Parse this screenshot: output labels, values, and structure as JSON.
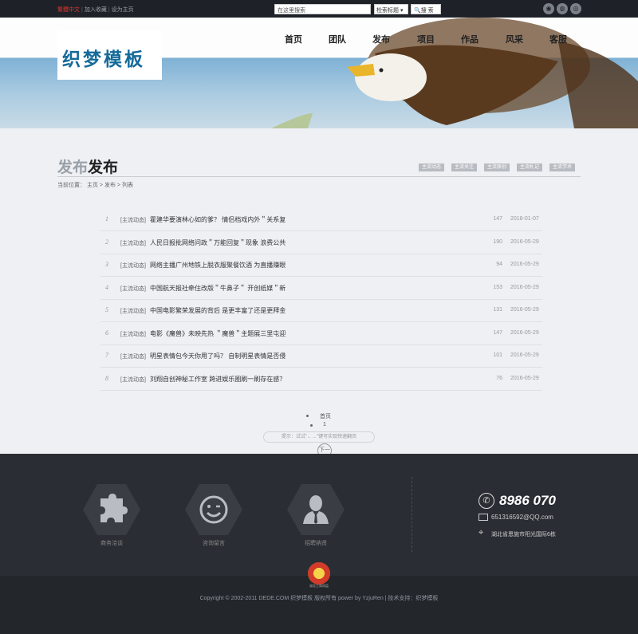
{
  "topbar": {
    "link_chinese": "繁體中文",
    "link_favorite": "加入收藏",
    "link_homepage": "设为主页",
    "search_placeholder": "在这里搜索",
    "search_select": "检索标题 ▾",
    "search_button": "搜 索",
    "social_icons": [
      "qq-icon",
      "wechat-icon",
      "weibo-icon"
    ]
  },
  "logo": {
    "text": "织梦模板"
  },
  "nav": [
    "首页",
    "团队",
    "发布",
    "项目",
    "作品",
    "风采",
    "客服"
  ],
  "page": {
    "heading_light": "发布",
    "heading_dark": "发布",
    "categories": [
      "主流动态",
      "主流关注",
      "主流原创",
      "主流札记",
      "主流学术"
    ],
    "breadcrumb": {
      "prefix": "当前位置：",
      "items": [
        "主页",
        "发布",
        "列表"
      ],
      "sep": ">"
    }
  },
  "articles": [
    {
      "num": "1",
      "tag": "[主流动态]",
      "title": "霍建华要演林心如的爹？ 情侣档戏内外＂关系复",
      "views": "147",
      "date": "2018-01-07"
    },
    {
      "num": "2",
      "tag": "[主流动态]",
      "title": "人民日报批网络问政＂万能回复＂现象 浪费公共",
      "views": "190",
      "date": "2016-05-29"
    },
    {
      "num": "3",
      "tag": "[主流动态]",
      "title": "网络主播广州地铁上脱衣服聚餐饮酒 为直播赚眼",
      "views": "94",
      "date": "2016-05-29"
    },
    {
      "num": "4",
      "tag": "[主流动态]",
      "title": "中国航天报社牵住改版＂牛鼻子＂ 开创纸媒＂新",
      "views": "153",
      "date": "2016-05-29"
    },
    {
      "num": "5",
      "tag": "[主流动态]",
      "title": "中国电影繁荣发展的背后 是更丰富了还是更拜金",
      "views": "131",
      "date": "2016-05-29"
    },
    {
      "num": "6",
      "tag": "[主流动态]",
      "title": "电影《魔兽》未映先热 ＂魔兽＂主题展三里屯迎",
      "views": "147",
      "date": "2016-05-29"
    },
    {
      "num": "7",
      "tag": "[主流动态]",
      "title": "明星表情包今天你用了吗？ 自制明星表情是否侵",
      "views": "101",
      "date": "2016-05-29"
    },
    {
      "num": "8",
      "tag": "[主流动态]",
      "title": "刘翔自创神秘工作室 跨进娱乐圈刷一刷存在感？",
      "views": "76",
      "date": "2016-05-29"
    }
  ],
  "pagination": {
    "first": "首页",
    "page": "1",
    "hint": "提示：试试\"←→\"键可实现快速翻页",
    "next": "下一"
  },
  "footer": {
    "services": [
      {
        "icon": "puzzle-icon",
        "label": "商务洽谈"
      },
      {
        "icon": "smile-icon",
        "label": "咨询留言"
      },
      {
        "icon": "person-icon",
        "label": "招聘纳贤"
      }
    ],
    "phone": "8986 070",
    "email": "651316592@QQ.com",
    "address": "湖北省恩施市阳光国际6栋",
    "badge_text": "湖北工商网监",
    "copyright": "Copyright © 2002-2011 DEDE.COM 织梦模板 版权所有 power by YzjuRen  | 技术支持：织梦模板"
  }
}
